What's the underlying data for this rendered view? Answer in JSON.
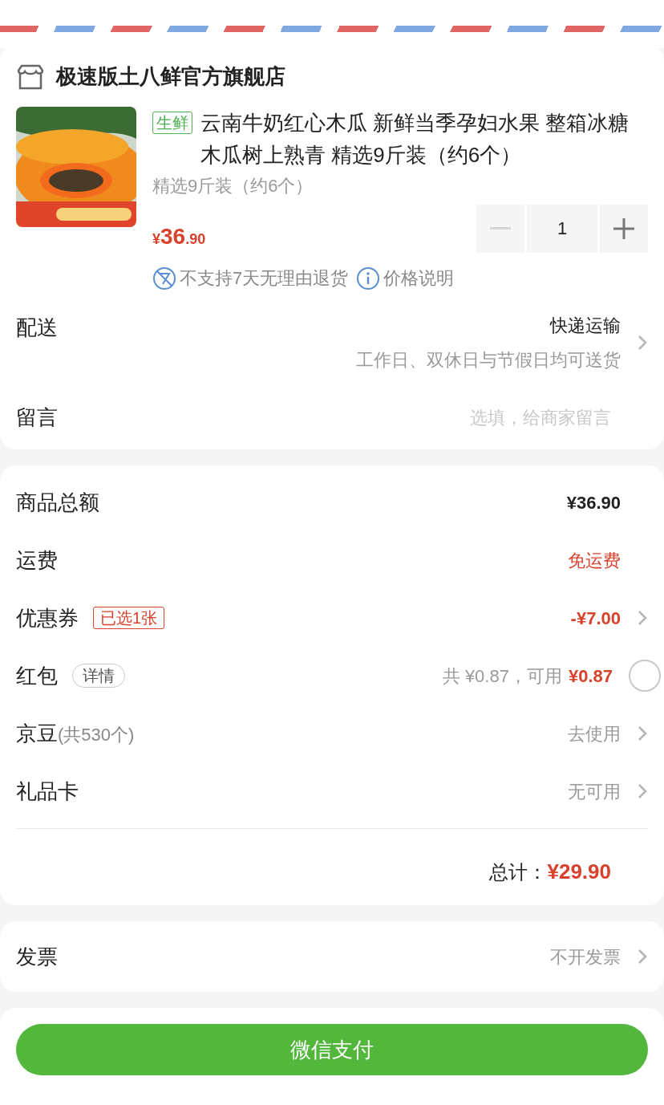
{
  "shop": {
    "name": "极速版土八鲜官方旗舰店"
  },
  "product": {
    "tag": "生鲜",
    "title": "云南牛奶红心木瓜 新鲜当季孕妇水果 整箱冰糖木瓜树上熟青 精选9斤装（约6个）",
    "spec": "精选9斤装（约6个）",
    "price_symbol": "¥",
    "price_int": "36",
    "price_dec": ".90",
    "quantity": "1",
    "decrease_disabled": true,
    "notes": [
      {
        "kind": "no-return",
        "text": "不支持7天无理由退货"
      },
      {
        "kind": "info",
        "text": "价格说明"
      }
    ]
  },
  "delivery": {
    "label": "配送",
    "value": "快递运输",
    "sub": "工作日、双休日与节假日均可送货",
    "chevron": true
  },
  "message": {
    "label": "留言",
    "placeholder": "选填，给商家留言"
  },
  "summary": {
    "rows": [
      {
        "label": "商品总额",
        "values": [
          {
            "text": "¥36.90",
            "red": false,
            "bold": true,
            "muted": false
          }
        ],
        "chevron": false
      },
      {
        "label": "运费",
        "values": [
          {
            "text": "免运费",
            "red": true,
            "bold": false,
            "muted": false
          }
        ],
        "chevron": false
      },
      {
        "label": "优惠券",
        "tag": {
          "text": "已选1张",
          "kind": "red"
        },
        "values": [
          {
            "text": "-¥7.00",
            "red": true,
            "bold": true,
            "muted": false
          }
        ],
        "chevron": true
      },
      {
        "label": "红包",
        "tag": {
          "text": "详情",
          "kind": "grey"
        },
        "values": [
          {
            "text": "共 ¥0.87，可用",
            "red": false,
            "bold": false,
            "muted": true
          },
          {
            "text": "¥0.87",
            "red": true,
            "bold": true,
            "muted": false
          }
        ],
        "radio": {
          "checked": false
        }
      },
      {
        "label": "京豆",
        "sub": "(共530个)",
        "values": [
          {
            "text": "去使用",
            "red": false,
            "bold": false,
            "muted": true
          }
        ],
        "chevron": true
      },
      {
        "label": "礼品卡",
        "values": [
          {
            "text": "无可用",
            "red": false,
            "bold": false,
            "muted": true
          }
        ],
        "chevron": true
      }
    ],
    "total_label": "总计：",
    "total_value": "¥29.90"
  },
  "invoice": {
    "label": "发票",
    "value": "不开发票",
    "chevron": true
  },
  "pay_button": "微信支付"
}
